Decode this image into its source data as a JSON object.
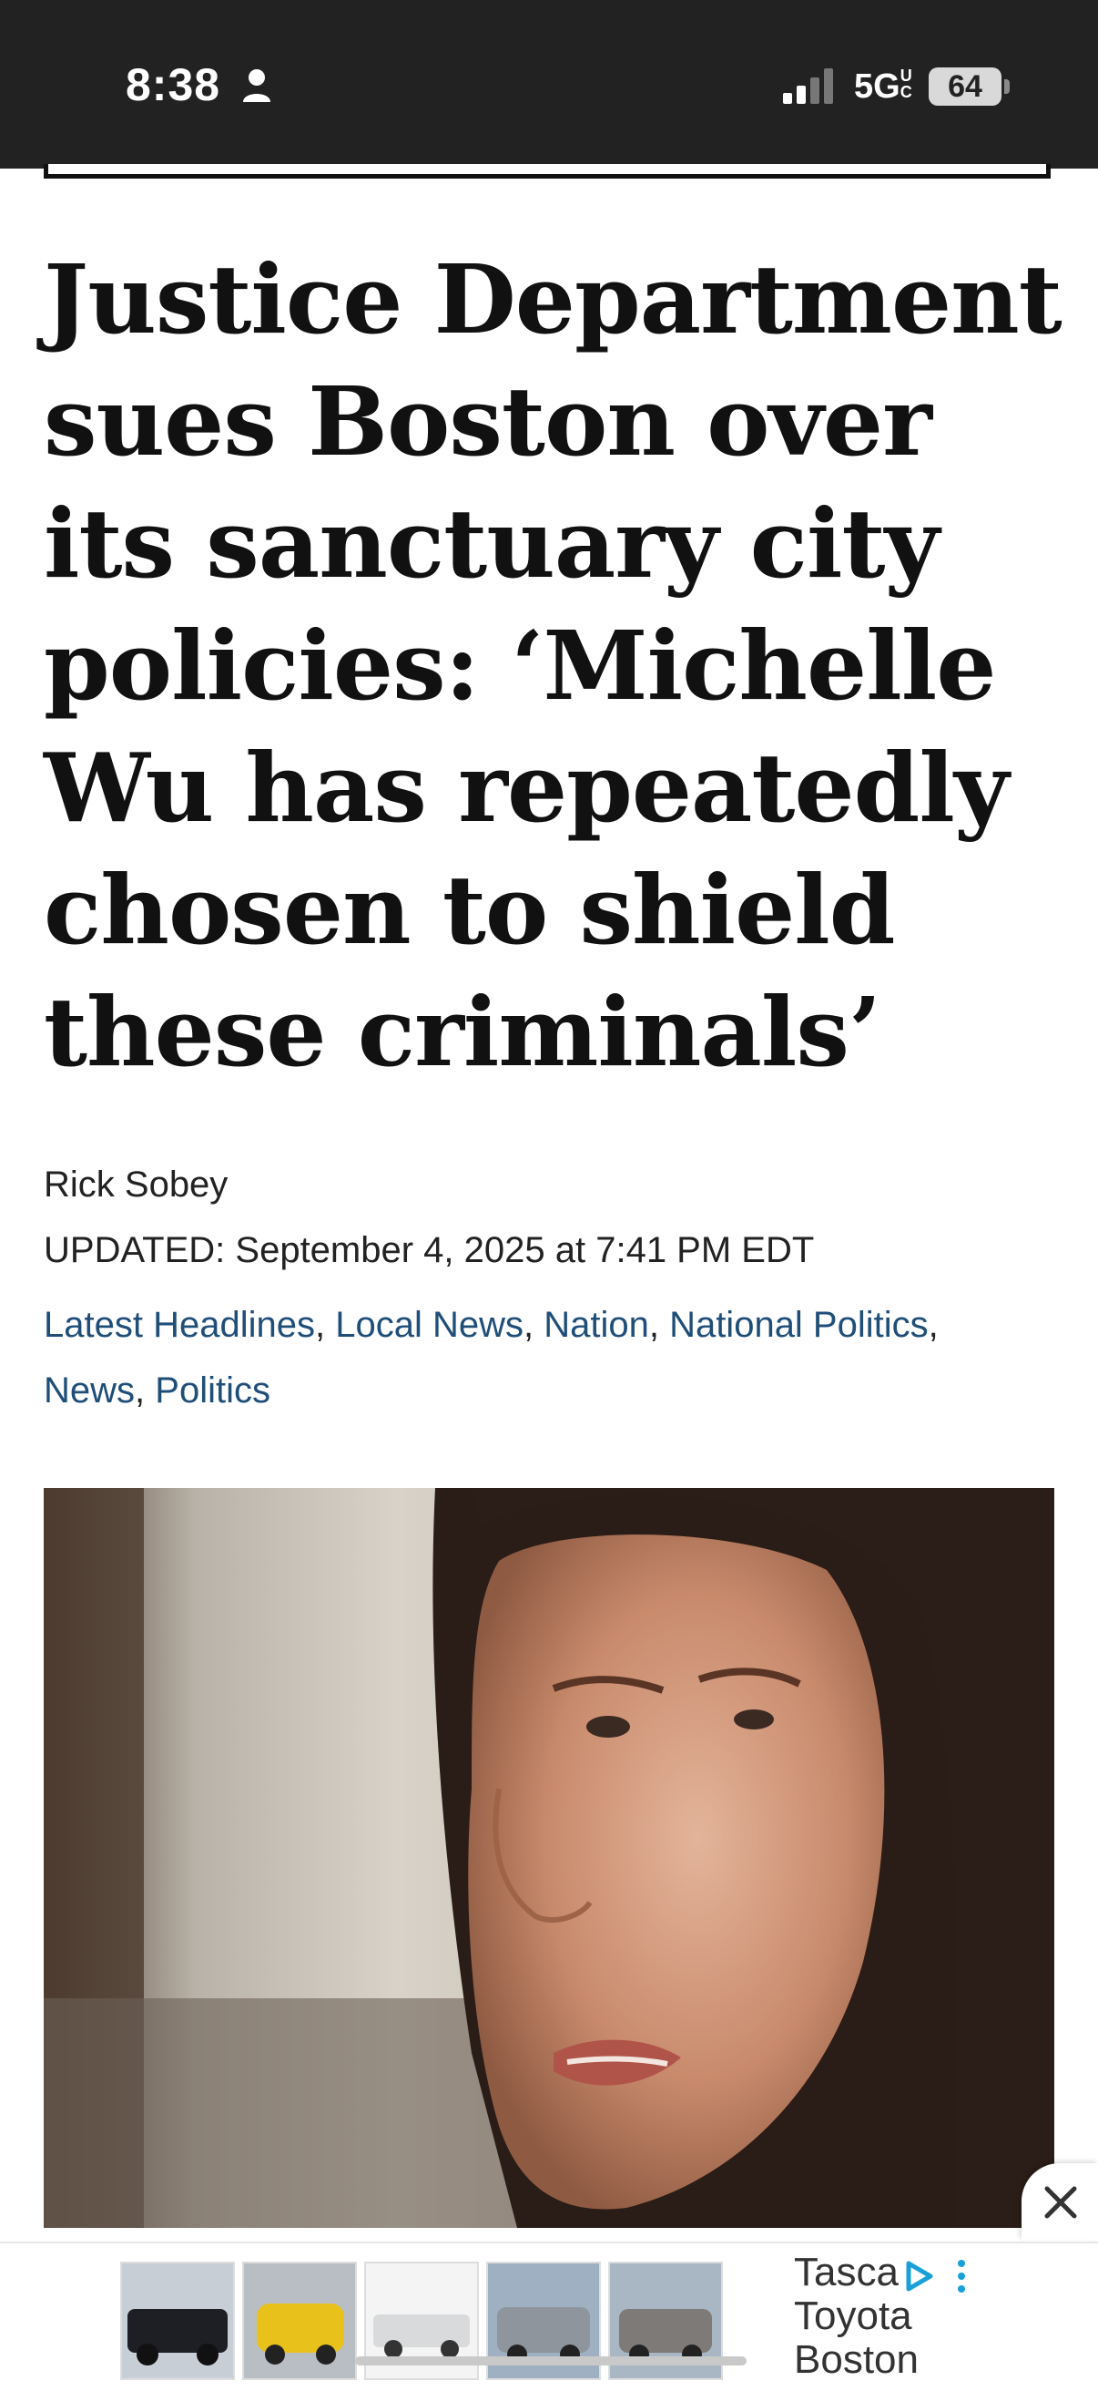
{
  "status_bar": {
    "time": "8:38",
    "network": "5G",
    "network_suffix": "UC",
    "battery": "64"
  },
  "article": {
    "headline": "Justice Department sues Boston over its sanctuary city policies: ‘Michelle Wu has repeatedly chosen to shield these criminals’",
    "author": "Rick Sobey",
    "updated": "UPDATED: September 4, 2025 at 7:41 PM EDT",
    "categories": [
      "Latest Headlines",
      "Local News",
      "Nation",
      "National Politics",
      "News",
      "Politics"
    ]
  },
  "ad": {
    "advertiser": "Tasca Toyota Boston",
    "close_icon": "close-icon",
    "choices_icon": "adchoices-icon"
  },
  "colors": {
    "status_bg": "#222222",
    "link": "#1f4e79",
    "headline": "#111111"
  }
}
